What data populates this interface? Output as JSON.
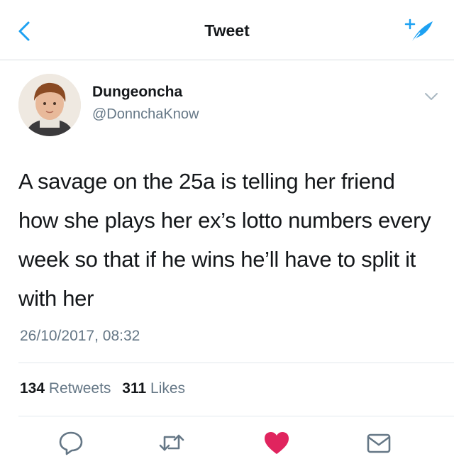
{
  "nav": {
    "title": "Tweet",
    "back_icon": "chevron-left-icon",
    "compose_icon": "compose-feather-icon",
    "accent": "#1da1f2"
  },
  "tweet": {
    "author_name": "Dungeoncha",
    "author_handle": "@DonnchaKnow",
    "text": "A savage on the 25a is telling her friend how she plays her ex’s lotto numbers every week so that if he wins he’ll have to split it with her",
    "timestamp": "26/10/2017, 08:32",
    "retweets_count": "134",
    "retweets_label": "Retweets",
    "likes_count": "311",
    "likes_label": "Likes",
    "liked": true
  },
  "actions": {
    "reply_icon": "reply-icon",
    "retweet_icon": "retweet-icon",
    "like_icon": "heart-icon",
    "like_color": "#e0245e",
    "share_icon": "share-icon"
  }
}
